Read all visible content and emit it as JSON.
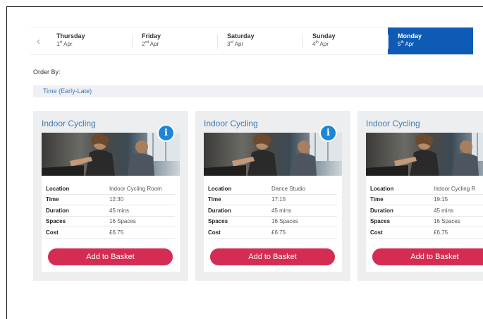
{
  "schedule": {
    "prev_icon": "chevron-left-icon",
    "days": [
      {
        "name": "Thursday",
        "day": "1",
        "suffix": "st",
        "month": "Apr",
        "active": false
      },
      {
        "name": "Friday",
        "day": "2",
        "suffix": "nd",
        "month": "Apr",
        "active": false
      },
      {
        "name": "Saturday",
        "day": "3",
        "suffix": "rd",
        "month": "Apr",
        "active": false
      },
      {
        "name": "Sunday",
        "day": "4",
        "suffix": "th",
        "month": "Apr",
        "active": false
      },
      {
        "name": "Monday",
        "day": "5",
        "suffix": "th",
        "month": "Apr",
        "active": true
      }
    ]
  },
  "order": {
    "label": "Order By:",
    "selected": "Time (Early-Late)"
  },
  "labels": {
    "location": "Location",
    "time": "Time",
    "duration": "Duration",
    "spaces": "Spaces",
    "cost": "Cost",
    "add_button": "Add to Basket",
    "info_icon": "info-icon",
    "info_glyph": "i"
  },
  "classes": [
    {
      "title": "Indoor Cycling",
      "location": "Indoor Cycling Room",
      "time": "12:30",
      "duration": "45 mins",
      "spaces": "16 Spaces",
      "cost": "£6.75"
    },
    {
      "title": "Indoor Cycling",
      "location": "Dance Studio",
      "time": "17:15",
      "duration": "45 mins",
      "spaces": "16 Spaces",
      "cost": "£6.75"
    },
    {
      "title": "Indoor Cycling",
      "location": "Indoor Cycling R",
      "time": "19:15",
      "duration": "45 mins",
      "spaces": "16 Spaces",
      "cost": "£6.75"
    }
  ],
  "colors": {
    "active_day": "#0d5bb5",
    "button": "#d42c52",
    "title": "#3f7ab0",
    "info": "#1f86d7"
  }
}
